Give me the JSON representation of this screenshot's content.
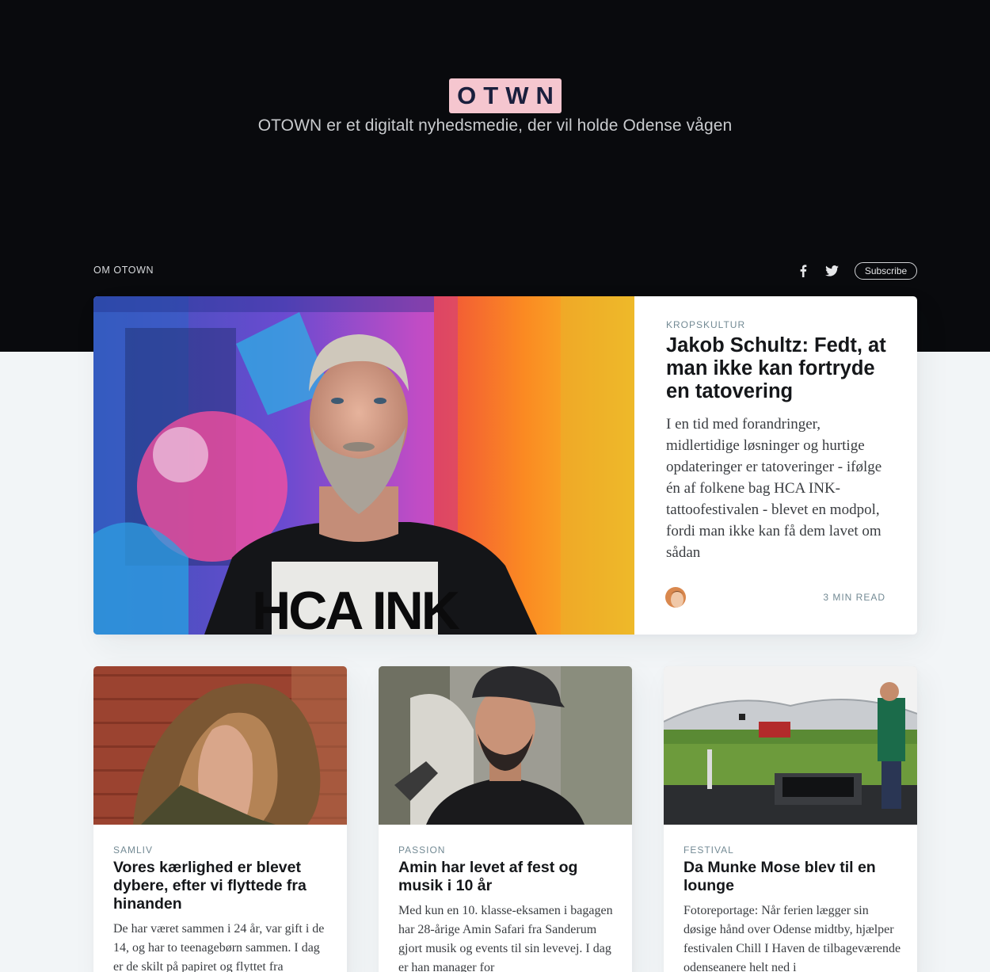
{
  "site": {
    "logo_text": "OTWN",
    "tagline": "OTOWN er et digitalt nyhedsmedie, der vil holde Odense vågen",
    "nav_link": "OM OTOWN",
    "subscribe_label": "Subscribe",
    "brand_color": "#f5c6cf",
    "header_bg": "#090a0d"
  },
  "social": [
    "facebook-icon",
    "twitter-icon"
  ],
  "featured": {
    "tag": "KROPSKULTUR",
    "title": "Jakob Schultz: Fedt, at man ikke kan fortryde en tatovering",
    "excerpt": "I en tid med forandringer, midlertidige løsninger og hurtige opdateringer er tatoveringer - ifølge én af folkene bag HCA INK-tattoofestivalen - blevet en modpol, fordi man ikke kan få dem lavet om sådan",
    "read_time": "3 MIN READ",
    "shirt_text": "HCA INK"
  },
  "cards": [
    {
      "tag": "SAMLIV",
      "title": "Vores kærlighed er blevet dybere, efter vi flyttede fra hinanden",
      "excerpt": "De har været sammen i 24 år, var gift i de 14, og har to teenagebørn sammen. I dag er de skilt på papiret og flyttet fra"
    },
    {
      "tag": "PASSION",
      "title": "Amin har levet af fest og musik i 10 år",
      "excerpt": "Med kun en 10. klasse-eksamen i bagagen har 28-årige Amin Safari fra Sanderum gjort musik og events til sin levevej. I dag er han manager for"
    },
    {
      "tag": "FESTIVAL",
      "title": "Da Munke Mose blev til en lounge",
      "excerpt": "Fotoreportage: Når ferien lægger sin døsige hånd over Odense midtby, hjælper festivalen Chill I Haven de tilbageværende odenseanere helt ned i"
    }
  ]
}
